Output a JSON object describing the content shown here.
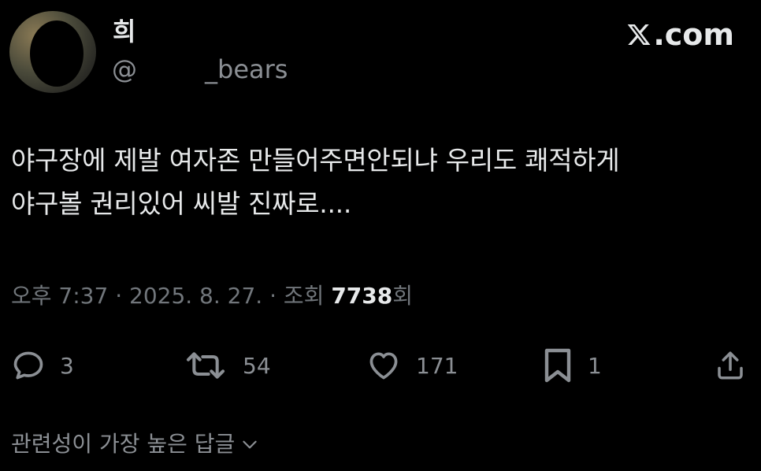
{
  "author": {
    "display_name": "희",
    "handle_prefix": "@",
    "handle_suffix": "_bears"
  },
  "brand": {
    "name": ".com",
    "icon": "x-logo-icon"
  },
  "tweet": {
    "lines": [
      "야구장에 제발 여자존 만들어주면안되냐 우리도 쾌적하게",
      "야구볼 권리있어 씨발 진짜로...."
    ]
  },
  "meta": {
    "time_date": "오후 7:37 · 2025. 8. 27. · 조회 ",
    "views": "7738",
    "views_suffix": "회"
  },
  "actions": {
    "reply": {
      "icon": "reply-icon",
      "count": "3"
    },
    "repost": {
      "icon": "repost-icon",
      "count": "54"
    },
    "like": {
      "icon": "heart-icon",
      "count": "171"
    },
    "bookmark": {
      "icon": "bookmark-icon",
      "count": "1"
    },
    "share": {
      "icon": "share-icon"
    }
  },
  "replies": {
    "sort_label": "관련성이 가장 높은 답글",
    "icon": "chevron-down-icon"
  },
  "colors": {
    "background": "#000000",
    "primary_text": "#e7e9ea",
    "secondary_text": "#71767b"
  }
}
